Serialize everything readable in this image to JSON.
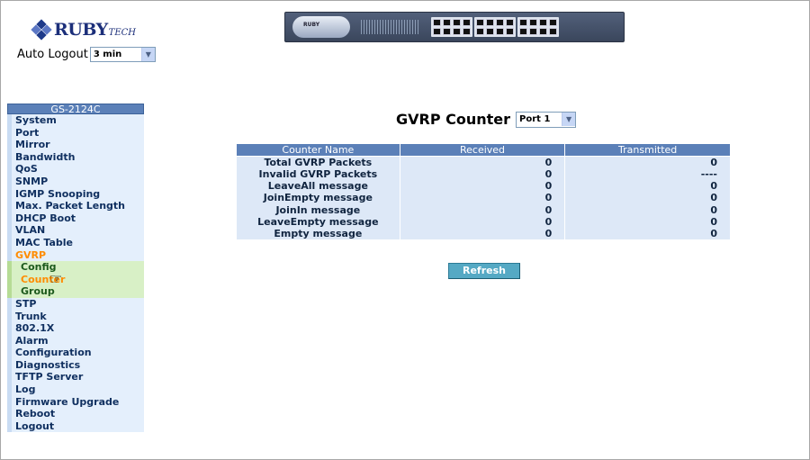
{
  "header": {
    "logo_text": "RUBY",
    "logo_suffix": "TECH",
    "auto_logout_label": "Auto Logout",
    "auto_logout_value": "3 min",
    "device_brand": "RUBY"
  },
  "sidebar": {
    "title": "GS-2124C",
    "items": [
      {
        "label": "System"
      },
      {
        "label": "Port"
      },
      {
        "label": "Mirror"
      },
      {
        "label": "Bandwidth"
      },
      {
        "label": "QoS"
      },
      {
        "label": "SNMP"
      },
      {
        "label": "IGMP Snooping"
      },
      {
        "label": "Max. Packet Length"
      },
      {
        "label": "DHCP Boot"
      },
      {
        "label": "VLAN"
      },
      {
        "label": "MAC Table"
      },
      {
        "label": "GVRP"
      }
    ],
    "gvrp_sub": [
      {
        "label": "Config"
      },
      {
        "label": "Counter"
      },
      {
        "label": "Group"
      }
    ],
    "items_after": [
      {
        "label": "STP"
      },
      {
        "label": "Trunk"
      },
      {
        "label": "802.1X"
      },
      {
        "label": "Alarm"
      },
      {
        "label": "Configuration"
      },
      {
        "label": "Diagnostics"
      },
      {
        "label": "TFTP Server"
      },
      {
        "label": "Log"
      },
      {
        "label": "Firmware Upgrade"
      },
      {
        "label": "Reboot"
      },
      {
        "label": "Logout"
      }
    ]
  },
  "main": {
    "title": "GVRP Counter",
    "port_select": "Port 1",
    "table": {
      "headers": [
        "Counter Name",
        "Received",
        "Transmitted"
      ],
      "rows": [
        [
          "Total GVRP Packets",
          "0",
          "0"
        ],
        [
          "Invalid GVRP Packets",
          "0",
          "----"
        ],
        [
          "LeaveAll message",
          "0",
          "0"
        ],
        [
          "JoinEmpty message",
          "0",
          "0"
        ],
        [
          "JoinIn message",
          "0",
          "0"
        ],
        [
          "LeaveEmpty message",
          "0",
          "0"
        ],
        [
          "Empty message",
          "0",
          "0"
        ]
      ]
    },
    "refresh_label": "Refresh"
  },
  "colors": {
    "header_blue": "#5b80b8",
    "active_orange": "#ff8c00",
    "refresh_teal": "#55a9c4"
  }
}
